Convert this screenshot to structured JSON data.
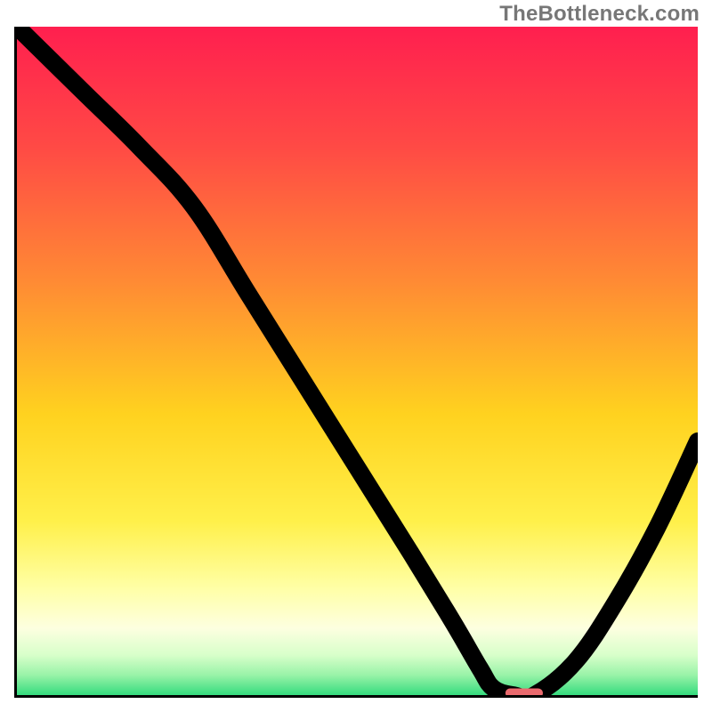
{
  "watermark": "TheBottleneck.com",
  "chart_data": {
    "type": "line",
    "title": "",
    "xlabel": "",
    "ylabel": "",
    "xlim": [
      0,
      100
    ],
    "ylim": [
      0,
      100
    ],
    "x": [
      0,
      10,
      18,
      26,
      34,
      42,
      50,
      58,
      64,
      68,
      70,
      73,
      76,
      82,
      88,
      94,
      100
    ],
    "values": [
      100,
      90,
      82,
      73,
      60,
      47,
      34,
      21,
      11,
      4,
      1,
      0,
      0,
      5,
      14,
      25,
      38
    ],
    "marker": {
      "x": 74.5,
      "y": 0,
      "width_pct": 5.5,
      "height_pct": 1.4,
      "color": "#ea6a6e"
    },
    "bg_gradient_stops": [
      {
        "offset": 0.0,
        "color": "#ff1f4f"
      },
      {
        "offset": 0.18,
        "color": "#ff4a45"
      },
      {
        "offset": 0.38,
        "color": "#ff8a34"
      },
      {
        "offset": 0.58,
        "color": "#ffd21f"
      },
      {
        "offset": 0.74,
        "color": "#fff04a"
      },
      {
        "offset": 0.84,
        "color": "#ffffa6"
      },
      {
        "offset": 0.9,
        "color": "#fdffe0"
      },
      {
        "offset": 0.94,
        "color": "#d8ffca"
      },
      {
        "offset": 0.97,
        "color": "#99f3a8"
      },
      {
        "offset": 1.0,
        "color": "#35db7e"
      }
    ]
  }
}
